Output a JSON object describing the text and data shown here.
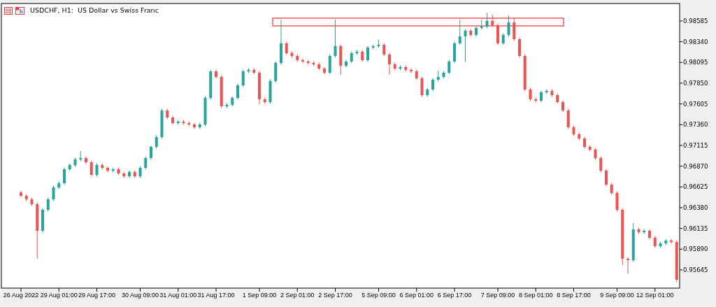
{
  "chart": {
    "highlight_zone": true,
    "chart_data": {
      "type": "candlestick",
      "title": "USDCHF, H1:  US Dollar vs Swiss Franc",
      "yticks": [
        {
          "value": 0.98585,
          "label": "0.98585"
        },
        {
          "value": 0.9834,
          "label": "0.98340"
        },
        {
          "value": 0.98095,
          "label": "0.98095"
        },
        {
          "value": 0.9785,
          "label": "0.97850"
        },
        {
          "value": 0.97605,
          "label": "0.97605"
        },
        {
          "value": 0.9736,
          "label": "0.97360"
        },
        {
          "value": 0.97115,
          "label": "0.97115"
        },
        {
          "value": 0.9687,
          "label": "0.96870"
        },
        {
          "value": 0.96625,
          "label": "0.96625"
        },
        {
          "value": 0.9638,
          "label": "0.96380"
        },
        {
          "value": 0.96135,
          "label": "0.96135"
        },
        {
          "value": 0.9589,
          "label": "0.95890"
        },
        {
          "value": 0.95645,
          "label": "0.95645"
        }
      ],
      "ylim": [
        0.9543,
        0.98791
      ],
      "categories": [
        "26 Aug 2022",
        null,
        null,
        null,
        null,
        null,
        null,
        "29 Aug 01:00",
        null,
        null,
        null,
        null,
        null,
        null,
        "29 Aug 17:00",
        null,
        null,
        null,
        null,
        null,
        null,
        null,
        "30 Aug 09:00",
        null,
        null,
        null,
        null,
        null,
        null,
        "31 Aug 01:00",
        null,
        null,
        null,
        null,
        null,
        null,
        "31 Aug 17:00",
        null,
        null,
        null,
        null,
        null,
        null,
        null,
        "1 Sep 09:00",
        null,
        null,
        null,
        null,
        null,
        null,
        "2 Sep 01:00",
        null,
        null,
        null,
        null,
        null,
        null,
        "2 Sep 17:00",
        null,
        null,
        null,
        null,
        null,
        null,
        null,
        "5 Sep 09:00",
        null,
        null,
        null,
        null,
        null,
        null,
        "6 Sep 01:00",
        null,
        null,
        null,
        null,
        null,
        null,
        "6 Sep 17:00",
        null,
        null,
        null,
        null,
        null,
        null,
        null,
        "7 Sep 09:00",
        null,
        null,
        null,
        null,
        null,
        null,
        "8 Sep 01:00",
        null,
        null,
        null,
        null,
        null,
        null,
        "8 Sep 17:00",
        null,
        null,
        null,
        null,
        null,
        null,
        null,
        "9 Sep 09:00",
        null,
        null,
        null,
        null,
        null,
        null,
        "12 Sep 01:00",
        null,
        null,
        null,
        null
      ],
      "ohlc": [
        [
          0.9656,
          0.9658,
          0.965,
          0.9652
        ],
        [
          0.9652,
          0.9654,
          0.96459,
          0.96479
        ],
        [
          0.96479,
          0.96499,
          0.96401,
          0.96421
        ],
        [
          0.96421,
          0.96441,
          0.9578,
          0.96107
        ],
        [
          0.96107,
          0.96375,
          0.96087,
          0.96355
        ],
        [
          0.96355,
          0.96499,
          0.96335,
          0.96479
        ],
        [
          0.96479,
          0.96639,
          0.96459,
          0.96619
        ],
        [
          0.96619,
          0.96689,
          0.96599,
          0.96669
        ],
        [
          0.96669,
          0.96854,
          0.96649,
          0.96834
        ],
        [
          0.96834,
          0.96903,
          0.96814,
          0.96883
        ],
        [
          0.96883,
          0.9697,
          0.96863,
          0.9695
        ],
        [
          0.9695,
          0.9705,
          0.9693,
          0.96966
        ],
        [
          0.96966,
          0.96986,
          0.96896,
          0.96916
        ],
        [
          0.96916,
          0.96936,
          0.96748,
          0.96768
        ],
        [
          0.96768,
          0.96903,
          0.96748,
          0.96883
        ],
        [
          0.96883,
          0.96903,
          0.9683,
          0.9685
        ],
        [
          0.9685,
          0.9687,
          0.96797,
          0.96817
        ],
        [
          0.96817,
          0.96854,
          0.96797,
          0.96834
        ],
        [
          0.96834,
          0.96854,
          0.96764,
          0.96784
        ],
        [
          0.96784,
          0.96804,
          0.96731,
          0.96751
        ],
        [
          0.96751,
          0.96821,
          0.96731,
          0.96801
        ],
        [
          0.96801,
          0.96821,
          0.96731,
          0.96751
        ],
        [
          0.96751,
          0.9687,
          0.96731,
          0.9685
        ],
        [
          0.9685,
          0.96986,
          0.9683,
          0.96966
        ],
        [
          0.96966,
          0.97118,
          0.96946,
          0.97098
        ],
        [
          0.97098,
          0.97234,
          0.97078,
          0.97214
        ],
        [
          0.97214,
          0.97548,
          0.97194,
          0.97528
        ],
        [
          0.97528,
          0.97548,
          0.97425,
          0.97445
        ],
        [
          0.97445,
          0.97465,
          0.97359,
          0.97379
        ],
        [
          0.97379,
          0.97416,
          0.97359,
          0.97396
        ],
        [
          0.97396,
          0.97416,
          0.97359,
          0.97379
        ],
        [
          0.97379,
          0.97399,
          0.97343,
          0.97363
        ],
        [
          0.97363,
          0.97383,
          0.97309,
          0.97329
        ],
        [
          0.97329,
          0.97383,
          0.97309,
          0.97363
        ],
        [
          0.97363,
          0.97696,
          0.97343,
          0.97676
        ],
        [
          0.97676,
          0.9801,
          0.97656,
          0.9799
        ],
        [
          0.9799,
          0.9801,
          0.97904,
          0.97924
        ],
        [
          0.97924,
          0.97944,
          0.97557,
          0.97577
        ],
        [
          0.97577,
          0.97614,
          0.97557,
          0.97594
        ],
        [
          0.97594,
          0.97696,
          0.97574,
          0.97676
        ],
        [
          0.97676,
          0.97845,
          0.97656,
          0.97825
        ],
        [
          0.97825,
          0.9801,
          0.97805,
          0.9799
        ],
        [
          0.9799,
          0.98027,
          0.9797,
          0.98007
        ],
        [
          0.98007,
          0.98027,
          0.97954,
          0.97974
        ],
        [
          0.97974,
          0.97994,
          0.976,
          0.9766
        ],
        [
          0.9766,
          0.9768,
          0.97607,
          0.97627
        ],
        [
          0.97627,
          0.97895,
          0.97607,
          0.97875
        ],
        [
          0.97875,
          0.98109,
          0.97855,
          0.98089
        ],
        [
          0.98089,
          0.986,
          0.98069,
          0.98321
        ],
        [
          0.98321,
          0.98341,
          0.98185,
          0.98205
        ],
        [
          0.98205,
          0.98225,
          0.98152,
          0.98172
        ],
        [
          0.98172,
          0.98192,
          0.98102,
          0.98122
        ],
        [
          0.98122,
          0.98142,
          0.98086,
          0.98106
        ],
        [
          0.98106,
          0.98126,
          0.98069,
          0.98089
        ],
        [
          0.98089,
          0.98109,
          0.98053,
          0.98073
        ],
        [
          0.98073,
          0.98093,
          0.98003,
          0.98023
        ],
        [
          0.98023,
          0.98043,
          0.97954,
          0.97974
        ],
        [
          0.97974,
          0.98192,
          0.97954,
          0.98172
        ],
        [
          0.98172,
          0.986,
          0.98152,
          0.98288
        ],
        [
          0.98288,
          0.98308,
          0.9795,
          0.98056
        ],
        [
          0.98056,
          0.98126,
          0.98036,
          0.98106
        ],
        [
          0.98106,
          0.98225,
          0.98086,
          0.98205
        ],
        [
          0.98205,
          0.98242,
          0.98185,
          0.98222
        ],
        [
          0.98222,
          0.98242,
          0.98102,
          0.98122
        ],
        [
          0.98122,
          0.98291,
          0.98102,
          0.98271
        ],
        [
          0.98271,
          0.98308,
          0.98251,
          0.98288
        ],
        [
          0.98288,
          0.9836,
          0.98268,
          0.98304
        ],
        [
          0.98304,
          0.98324,
          0.98169,
          0.98189
        ],
        [
          0.98189,
          0.98209,
          0.9795,
          0.98073
        ],
        [
          0.98073,
          0.98093,
          0.98003,
          0.98023
        ],
        [
          0.98023,
          0.9806,
          0.98003,
          0.9804
        ],
        [
          0.9804,
          0.9806,
          0.97987,
          0.98007
        ],
        [
          0.98007,
          0.98027,
          0.9797,
          0.9799
        ],
        [
          0.9799,
          0.9801,
          0.97888,
          0.97908
        ],
        [
          0.97908,
          0.97928,
          0.97689,
          0.97709
        ],
        [
          0.97709,
          0.97796,
          0.97689,
          0.97776
        ],
        [
          0.97776,
          0.97911,
          0.97756,
          0.97891
        ],
        [
          0.97891,
          0.98,
          0.97871,
          0.97924
        ],
        [
          0.97924,
          0.97994,
          0.97904,
          0.97974
        ],
        [
          0.97974,
          0.98126,
          0.97954,
          0.98106
        ],
        [
          0.98106,
          0.98341,
          0.98086,
          0.98321
        ],
        [
          0.98321,
          0.986,
          0.98301,
          0.98403
        ],
        [
          0.98403,
          0.98489,
          0.981,
          0.98469
        ],
        [
          0.98469,
          0.98489,
          0.984,
          0.9842
        ],
        [
          0.9842,
          0.98522,
          0.984,
          0.98502
        ],
        [
          0.98502,
          0.986,
          0.98482,
          0.98519
        ],
        [
          0.98519,
          0.9868,
          0.98499,
          0.98585
        ],
        [
          0.98585,
          0.9866,
          0.98515,
          0.98535
        ],
        [
          0.98535,
          0.98555,
          0.98301,
          0.98321
        ],
        [
          0.98321,
          0.9844,
          0.98301,
          0.9842
        ],
        [
          0.9842,
          0.9865,
          0.984,
          0.98568
        ],
        [
          0.98568,
          0.9862,
          0.9835,
          0.9837
        ],
        [
          0.9837,
          0.9839,
          0.98152,
          0.98172
        ],
        [
          0.98172,
          0.98192,
          0.97756,
          0.97776
        ],
        [
          0.97776,
          0.97796,
          0.9764,
          0.9766
        ],
        [
          0.9766,
          0.9768,
          0.97623,
          0.97643
        ],
        [
          0.97643,
          0.97762,
          0.97623,
          0.97742
        ],
        [
          0.97742,
          0.97779,
          0.97722,
          0.97759
        ],
        [
          0.97759,
          0.97779,
          0.97689,
          0.97709
        ],
        [
          0.97709,
          0.97729,
          0.97607,
          0.97627
        ],
        [
          0.97627,
          0.97647,
          0.97508,
          0.97528
        ],
        [
          0.97528,
          0.97548,
          0.97309,
          0.97329
        ],
        [
          0.97329,
          0.97349,
          0.97227,
          0.97247
        ],
        [
          0.97247,
          0.97267,
          0.97177,
          0.97197
        ],
        [
          0.97197,
          0.97217,
          0.97078,
          0.97098
        ],
        [
          0.97098,
          0.97118,
          0.97045,
          0.97065
        ],
        [
          0.97065,
          0.97085,
          0.96946,
          0.96966
        ],
        [
          0.96966,
          0.96986,
          0.96797,
          0.96817
        ],
        [
          0.96817,
          0.96837,
          0.96632,
          0.96652
        ],
        [
          0.96652,
          0.96672,
          0.96533,
          0.96553
        ],
        [
          0.96553,
          0.96573,
          0.96335,
          0.96355
        ],
        [
          0.96355,
          0.96375,
          0.957,
          0.95777
        ],
        [
          0.95777,
          0.95797,
          0.956,
          0.9576
        ],
        [
          0.9576,
          0.962,
          0.9574,
          0.96124
        ],
        [
          0.96124,
          0.96144,
          0.9607,
          0.9609
        ],
        [
          0.9609,
          0.96127,
          0.9607,
          0.96107
        ],
        [
          0.96107,
          0.96127,
          0.96004,
          0.96024
        ],
        [
          0.96024,
          0.96044,
          0.95905,
          0.95925
        ],
        [
          0.95925,
          0.95978,
          0.95905,
          0.95958
        ],
        [
          0.95958,
          0.96011,
          0.95938,
          0.95991
        ],
        [
          0.95991,
          0.96011,
          0.95955,
          0.95975
        ],
        [
          0.95975,
          0.95995,
          0.955,
          0.95529
        ]
      ]
    }
  }
}
